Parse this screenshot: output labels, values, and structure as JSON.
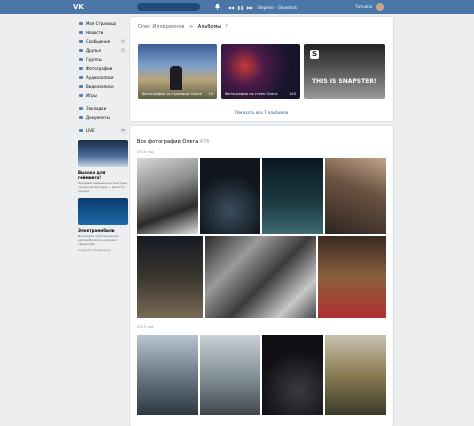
{
  "header": {
    "logo": "VK",
    "user_name": "Татьяна",
    "track": "Stephen - Glowstick",
    "player_icons": [
      "prev-icon",
      "pause-icon",
      "next-icon"
    ]
  },
  "sidebar": {
    "items": [
      {
        "label": "Моя Страница",
        "count": ""
      },
      {
        "label": "Новости",
        "count": ""
      },
      {
        "label": "Сообщения",
        "count": "3"
      },
      {
        "label": "Друзья",
        "count": "2"
      },
      {
        "label": "Группы",
        "count": ""
      },
      {
        "label": "Фотографии",
        "count": ""
      },
      {
        "label": "Аудиозаписи",
        "count": ""
      },
      {
        "label": "Видеозаписи",
        "count": ""
      },
      {
        "label": "Игры",
        "count": ""
      }
    ],
    "items2": [
      {
        "label": "Закладки"
      },
      {
        "label": "Документы"
      }
    ],
    "live": {
      "label": "LIVE",
      "count": "16"
    },
    "ad1": {
      "title": "Высоко для гейминга!",
      "text": "Продаём надежные и быстрые суперкомпьютеры + десятки призов"
    },
    "ad2": {
      "title": "Электромобили",
      "text": "Все марки электрических автомобилей в наличии с гарантией"
    },
    "create_ad": "Создать объявление"
  },
  "albums_card": {
    "breadcrumb_name": "Олег Илларионов",
    "breadcrumb_sep": ">",
    "breadcrumb_current": "Альбомы",
    "albums_count": "7",
    "albums": [
      {
        "caption": "Фотографии со страницы Олега",
        "count": "10"
      },
      {
        "caption": "Фотографии на стене Олега",
        "count": "243"
      },
      {
        "caption": "",
        "count": ""
      }
    ],
    "album3_overlay_text": "THIS IS SNAPSTER!",
    "show_all": "Показать все 7 альбомов"
  },
  "photos_card": {
    "title": "Все фотографии Олега",
    "count": "476",
    "years": [
      "2016 год",
      "2015 год"
    ]
  },
  "colors": {
    "accent": "#4a76a8",
    "link": "#2a5885",
    "bg": "#edeef0"
  }
}
